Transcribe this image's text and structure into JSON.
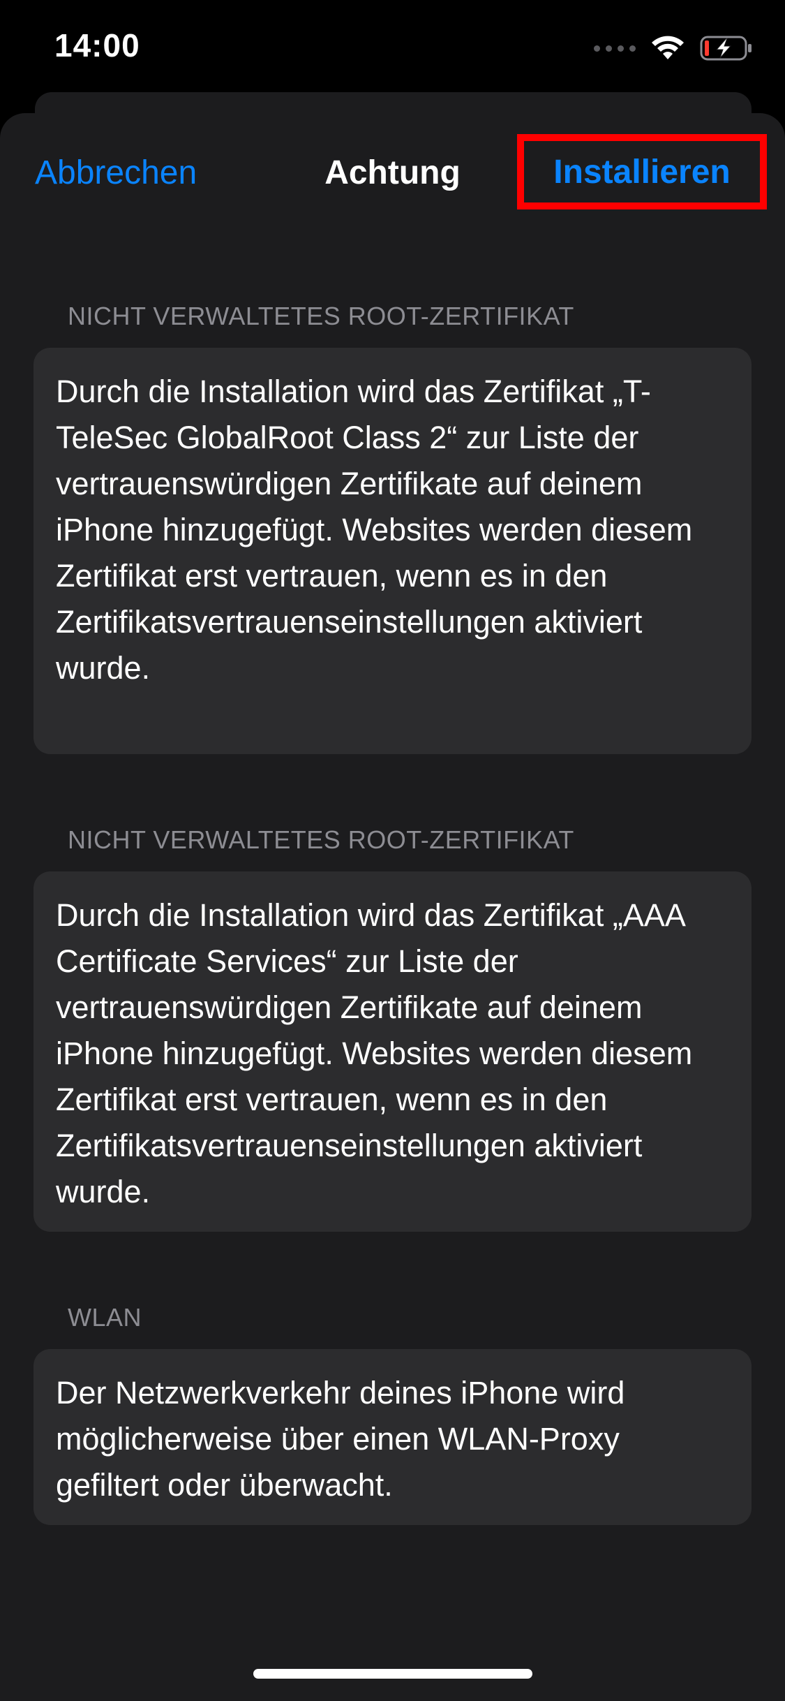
{
  "status_bar": {
    "time": "14:00",
    "icons": [
      "cellular-signal-icon",
      "wifi-icon",
      "battery-charging-icon"
    ],
    "battery_color": "#ff3b30"
  },
  "nav": {
    "cancel_label": "Abbrechen",
    "title": "Achtung",
    "install_label": "Installieren",
    "accent_color": "#0a84ff",
    "highlight_color": "#ff0000"
  },
  "sections": [
    {
      "header": "NICHT VERWALTETES ROOT-ZERTIFIKAT",
      "body": "Durch die Installation wird das Zertifikat „T-TeleSec GlobalRoot Class 2“ zur Liste der vertrauenswürdigen Zertifikate auf deinem iPhone hinzugefügt. Websites werden diesem Zertifikat erst vertrauen, wenn es in den Zertifikatsvertrauenseinstellungen aktiviert wurde."
    },
    {
      "header": "NICHT VERWALTETES ROOT-ZERTIFIKAT",
      "body": "Durch die Installation wird das Zertifikat „AAA Certificate Services“ zur Liste der vertrauenswürdigen Zertifikate auf deinem iPhone hinzugefügt. Websites werden diesem Zertifikat erst vertrauen, wenn es in den Zertifikatsvertrauenseinstellungen aktiviert wurde."
    },
    {
      "header": "WLAN",
      "body": "Der Netzwerkverkehr deines iPhone wird möglicherweise über einen WLAN-Proxy gefiltert oder überwacht."
    }
  ]
}
